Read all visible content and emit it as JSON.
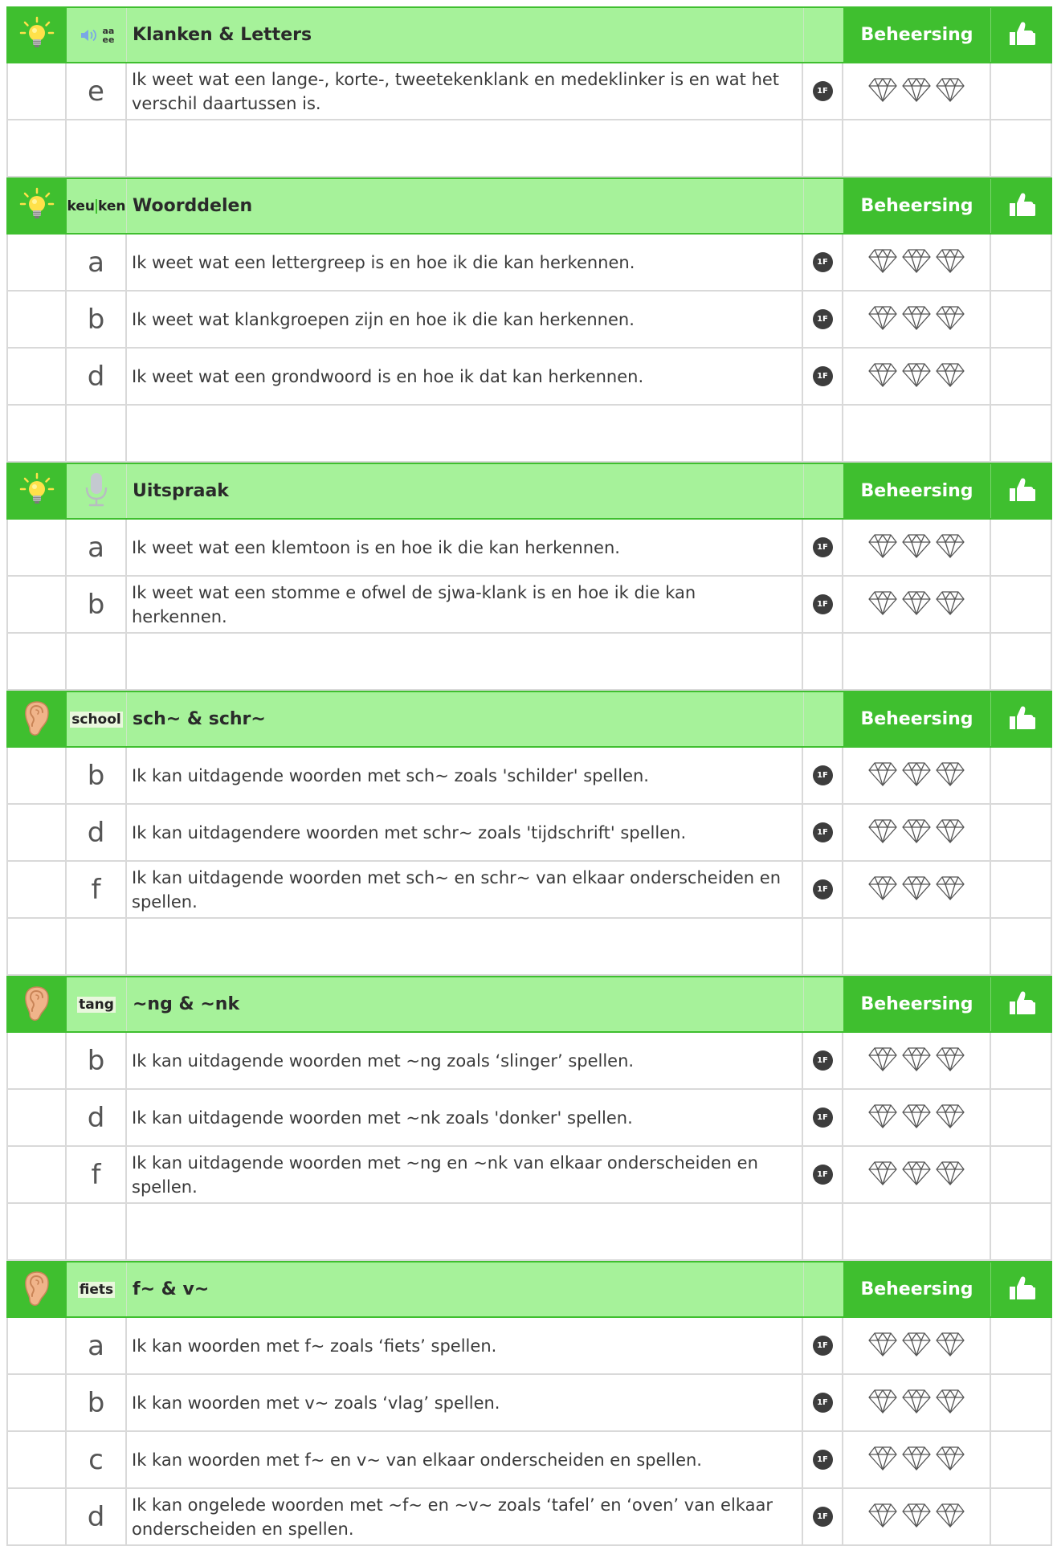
{
  "column_header": "Beheersing",
  "level_badge": "1F",
  "sections": [
    {
      "category_icon": "lightbulb-icon",
      "symbol": {
        "type": "speaker",
        "text": "aa ee"
      },
      "title": "Klanken & Letters",
      "items": [
        {
          "letter": "e",
          "text": "Ik weet wat een lange-, korte-, tweetekenklank en medeklinker is en wat het verschil daartussen is."
        }
      ]
    },
    {
      "category_icon": "lightbulb-icon",
      "symbol": {
        "type": "word",
        "text": "keu|ken"
      },
      "title": "Woorddelen",
      "items": [
        {
          "letter": "a",
          "text": "Ik weet wat een lettergreep is en hoe ik die kan herkennen."
        },
        {
          "letter": "b",
          "text": "Ik weet wat klankgroepen zijn en hoe ik die kan herkennen."
        },
        {
          "letter": "d",
          "text": "Ik weet wat een grondwoord is en hoe ik dat kan herkennen."
        }
      ]
    },
    {
      "category_icon": "lightbulb-icon",
      "symbol": {
        "type": "microphone",
        "text": ""
      },
      "title": "Uitspraak",
      "items": [
        {
          "letter": "a",
          "text": "Ik weet wat een klemtoon is en hoe ik die kan herkennen."
        },
        {
          "letter": "b",
          "text": "Ik weet wat een stomme e ofwel de sjwa-klank is en hoe ik die kan herkennen."
        }
      ]
    },
    {
      "category_icon": "ear-icon",
      "symbol": {
        "type": "word",
        "text": "school"
      },
      "title": "sch~ & schr~",
      "items": [
        {
          "letter": "b",
          "text": "Ik kan uitdagende woorden met sch~ zoals 'schilder' spellen."
        },
        {
          "letter": "d",
          "text": "Ik kan uitdagendere woorden met schr~ zoals 'tijdschrift' spellen."
        },
        {
          "letter": "f",
          "text": "Ik kan uitdagende woorden met sch~ en schr~ van elkaar onderscheiden en spellen."
        }
      ]
    },
    {
      "category_icon": "ear-icon",
      "symbol": {
        "type": "word",
        "text": "tang"
      },
      "title": "~ng & ~nk",
      "items": [
        {
          "letter": "b",
          "text": "Ik kan uitdagende woorden met ~ng zoals ‘slinger’ spellen."
        },
        {
          "letter": "d",
          "text": "Ik kan uitdagende woorden met ~nk zoals 'donker' spellen."
        },
        {
          "letter": "f",
          "text": "Ik kan uitdagende woorden met ~ng en ~nk van elkaar onderscheiden en spellen."
        }
      ]
    },
    {
      "category_icon": "ear-icon",
      "symbol": {
        "type": "word",
        "text": "fiets"
      },
      "title": "f~ & v~",
      "items": [
        {
          "letter": "a",
          "text": "Ik kan woorden met f~ zoals ‘fiets’ spellen."
        },
        {
          "letter": "b",
          "text": "Ik kan woorden met v~ zoals ‘vlag’ spellen."
        },
        {
          "letter": "c",
          "text": "Ik kan woorden met f~ en v~ van elkaar onderscheiden en spellen."
        },
        {
          "letter": "d",
          "text": "Ik kan ongelede woorden met ~f~ en ~v~ zoals ‘tafel’ en ‘oven’ van elkaar onderscheiden en spellen."
        }
      ]
    }
  ]
}
